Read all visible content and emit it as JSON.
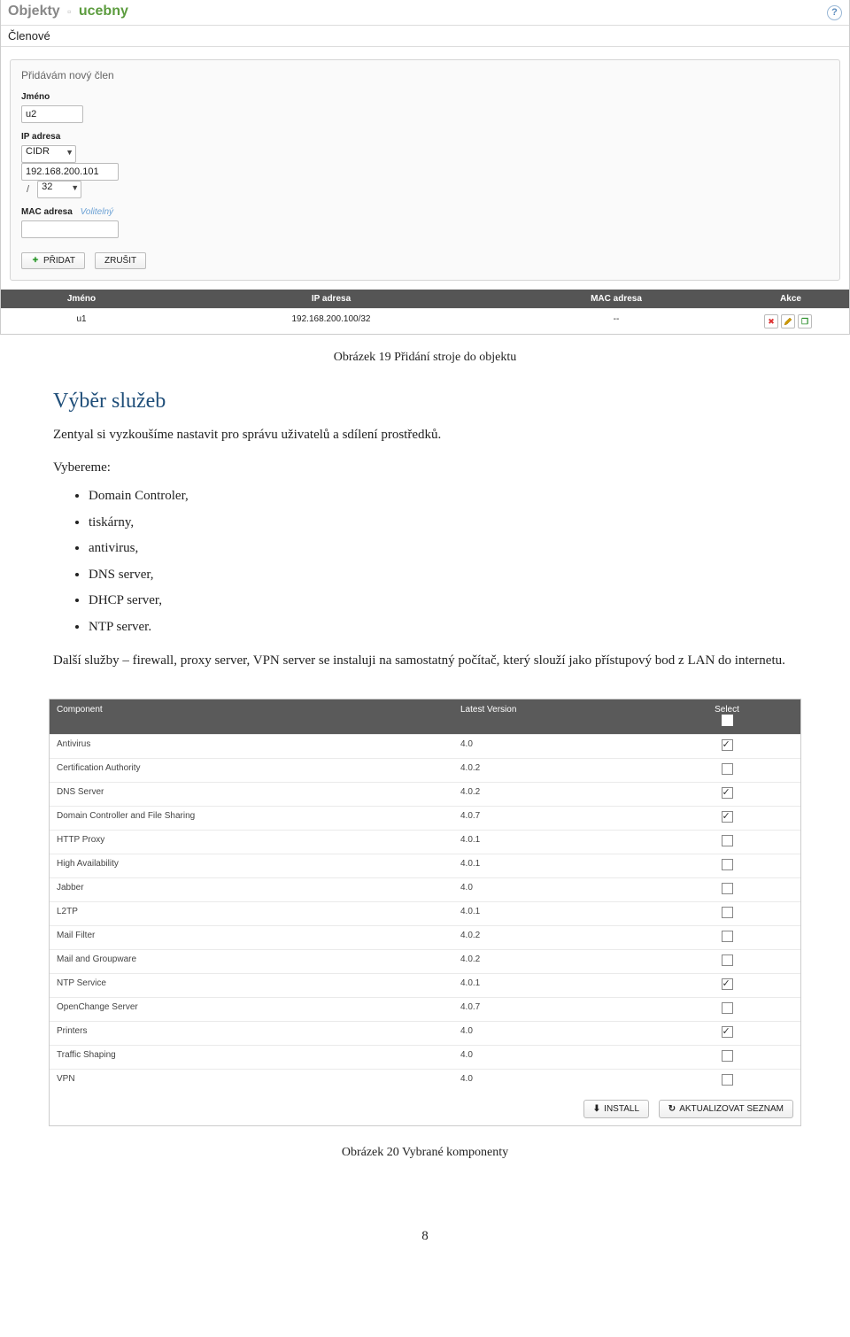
{
  "breadcrumb": {
    "root": "Objekty",
    "sep_glyph": "▫",
    "active": "ucebny",
    "help_glyph": "?"
  },
  "members_header": "Členové",
  "panel": {
    "title": "Přidávám nový člen",
    "jmeno_label": "Jméno",
    "jmeno_value": "u2",
    "ip_label": "IP adresa",
    "cidr_value": "CIDR",
    "ip_value": "192.168.200.101",
    "mask_value": "32",
    "mac_label": "MAC adresa",
    "mac_optional": "Volitelný",
    "mac_value": "",
    "add_btn": "PŘIDAT",
    "cancel_btn": "ZRUŠIT"
  },
  "grid": {
    "h_name": "Jméno",
    "h_ip": "IP adresa",
    "h_mac": "MAC adresa",
    "h_act": "Akce",
    "row": {
      "name": "u1",
      "ip": "192.168.200.100/32",
      "mac": "--"
    }
  },
  "caption1": "Obrázek 19 Přidání stroje do objektu",
  "sec_title": "Výběr služeb",
  "para1": "Zentyal si vyzkoušíme nastavit pro správu uživatelů a sdílení prostředků.",
  "vybereme": "Vybereme:",
  "bullets": [
    "Domain Controler,",
    "tiskárny,",
    "antivirus,",
    "DNS server,",
    "DHCP server,",
    "NTP server."
  ],
  "para2": "Další služby – firewall, proxy server, VPN server se instaluji na samostatný počítač, který slouží jako přístupový bod z LAN do internetu.",
  "table2": {
    "h_comp": "Component",
    "h_ver": "Latest Version",
    "h_sel": "Select",
    "rows": [
      {
        "name": "Antivirus",
        "ver": "4.0",
        "checked": true
      },
      {
        "name": "Certification Authority",
        "ver": "4.0.2",
        "checked": false
      },
      {
        "name": "DNS Server",
        "ver": "4.0.2",
        "checked": true
      },
      {
        "name": "Domain Controller and File Sharing",
        "ver": "4.0.7",
        "checked": true
      },
      {
        "name": "HTTP Proxy",
        "ver": "4.0.1",
        "checked": false
      },
      {
        "name": "High Availability",
        "ver": "4.0.1",
        "checked": false
      },
      {
        "name": "Jabber",
        "ver": "4.0",
        "checked": false
      },
      {
        "name": "L2TP",
        "ver": "4.0.1",
        "checked": false
      },
      {
        "name": "Mail Filter",
        "ver": "4.0.2",
        "checked": false
      },
      {
        "name": "Mail and Groupware",
        "ver": "4.0.2",
        "checked": false
      },
      {
        "name": "NTP Service",
        "ver": "4.0.1",
        "checked": true
      },
      {
        "name": "OpenChange Server",
        "ver": "4.0.7",
        "checked": false
      },
      {
        "name": "Printers",
        "ver": "4.0",
        "checked": true
      },
      {
        "name": "Traffic Shaping",
        "ver": "4.0",
        "checked": false
      },
      {
        "name": "VPN",
        "ver": "4.0",
        "checked": false
      }
    ],
    "install_btn": "INSTALL",
    "update_btn": "AKTUALIZOVAT SEZNAM"
  },
  "caption2": "Obrázek 20 Vybrané komponenty",
  "page_number": "8"
}
